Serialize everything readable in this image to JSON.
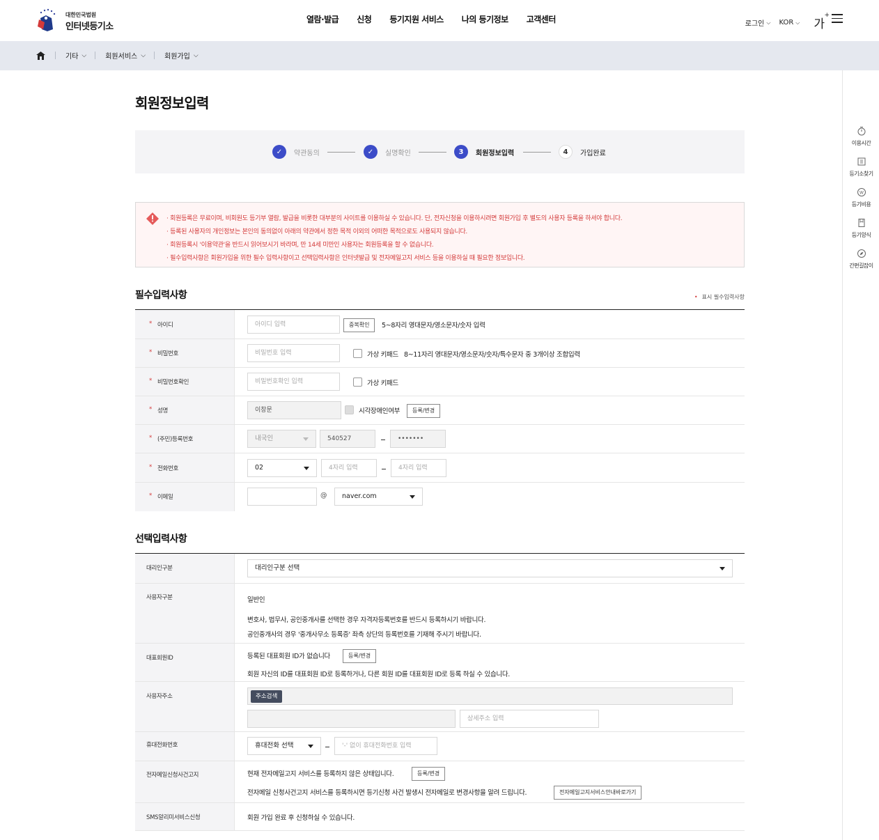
{
  "header": {
    "logo_small": "대한민국법원",
    "logo_big": "인터넷등기소",
    "nav": [
      "열람·발급",
      "신청",
      "등기지원 서비스",
      "나의 등기정보",
      "고객센터"
    ],
    "login": "로그인",
    "lang": "KOR",
    "font_btn": "가",
    "font_btn_sup": "+"
  },
  "breadcrumb": [
    "기타",
    "회원서비스",
    "회원가입"
  ],
  "quickbar": [
    "이용시간",
    "등기소찾기",
    "등기비용",
    "등기양식",
    "간편길잡이"
  ],
  "page_title": "회원정보입력",
  "steps": [
    {
      "num": "✓",
      "label": "약관동의",
      "state": "done"
    },
    {
      "num": "✓",
      "label": "실명확인",
      "state": "done"
    },
    {
      "num": "3",
      "label": "회원정보입력",
      "state": "current"
    },
    {
      "num": "4",
      "label": "가입완료",
      "state": "todo"
    }
  ],
  "notice": [
    "· 회원등록은 무료이며, 비회원도 등기부 열람, 발급을 비롯한 대부분의 사이트를 이용하실 수 있습니다. 단, 전자신청을 이용하시려면 회원가입 후 별도의 사용자 등록을 하셔야 합니다.",
    "· 등록된 사용자의 개인정보는 본인의 동의없이 아래의 약관에서 정한 목적 이외의 어떠한 목적으로도 사용되지 않습니다.",
    "· 회원등록시 '이용약관'을 반드시 읽어보시기 바라며, 만 14세 미만인 사용자는 회원등록을 할 수 없습니다.",
    "· 필수입력사항은 회원가입을 위한 필수 입력사항이고 선택입력사항은 인터넷발급 및 전자메일고지 서비스 등을 이용하실 때 필요한 정보입니다."
  ],
  "required": {
    "title": "필수입력사항",
    "note_star": "•",
    "note": "표시 필수입력사항",
    "star": "*",
    "id": {
      "label": "아이디",
      "placeholder": "아이디 입력",
      "btn": "중복확인",
      "hint": "5~8자리 영대문자/영소문자/숫자 입력"
    },
    "pw": {
      "label": "비밀번호",
      "placeholder": "비밀번호 입력",
      "vk": "가상 키패드",
      "hint": "8~11자리 영대문자/영소문자/숫자/특수문자 중 3개이상 조합입력"
    },
    "pw2": {
      "label": "비밀번호확인",
      "placeholder": "비밀번호확인 입력",
      "vk": "가상 키패드"
    },
    "name": {
      "label": "성명",
      "value": "이창문",
      "chk": "시각장애인여부",
      "btn": "등록/변경"
    },
    "rrn": {
      "label": "(주민)등록번호",
      "type": "내국인",
      "front": "540527",
      "back": "•••••••"
    },
    "phone": {
      "label": "전화번호",
      "area": "02",
      "p1": "4자리 입력",
      "p2": "4자리 입력"
    },
    "email": {
      "label": "이메일",
      "at": "@",
      "domain": "naver.com"
    }
  },
  "optional": {
    "title": "선택입력사항",
    "agent": {
      "label": "대리인구분",
      "value": "대리인구분 선택"
    },
    "usertype": {
      "label": "사용자구분",
      "value": "일반인",
      "desc1": "변호사, 법무사, 공인중개사를 선택한 경우 자격자등록번호를 반드시 등록하시기 바랍니다.",
      "desc2": "공인중개사의 경우 '중개사무소 등록증' 좌측 상단의 등록번호를 기재해 주시기 바랍니다."
    },
    "rep": {
      "label": "대표회원ID",
      "text": "등록된 대표회원 ID가 없습니다",
      "btn": "등록/변경",
      "desc": "회원 자신의 ID를 대표회원 ID로 등록하거나, 다른 회원 ID를 대표회원 ID로 등록 하실 수 있습니다."
    },
    "addr": {
      "label": "사용자주소",
      "btn": "주소검색",
      "detail": "상세주소 입력"
    },
    "mobile": {
      "label": "휴대전화번호",
      "sel": "휴대전화 선택",
      "placeholder": "'-' 없이 휴대전화번호 입력"
    },
    "emailnotice": {
      "label": "전자메일신청사건고지",
      "text1": "현재 전자메일고지 서비스를 등록하지 않은 상태입니다.",
      "btn": "등록/변경",
      "text2": "전자메일 신청사건고지 서비스를 등록하시면 등기신청 사건 발생시 전자메일로 변경사항을 알려 드립니다.",
      "btn2": "전자메일고지서비스안내바로가기"
    },
    "sms": {
      "label": "SMS알리미서비스신청",
      "text": "회원 가입 완료 후 신청하실 수 있습니다."
    }
  },
  "colors": {
    "accent": "#3c4cc8",
    "warning": "#d33a3a",
    "crumb_bg": "#e5e8ef"
  }
}
